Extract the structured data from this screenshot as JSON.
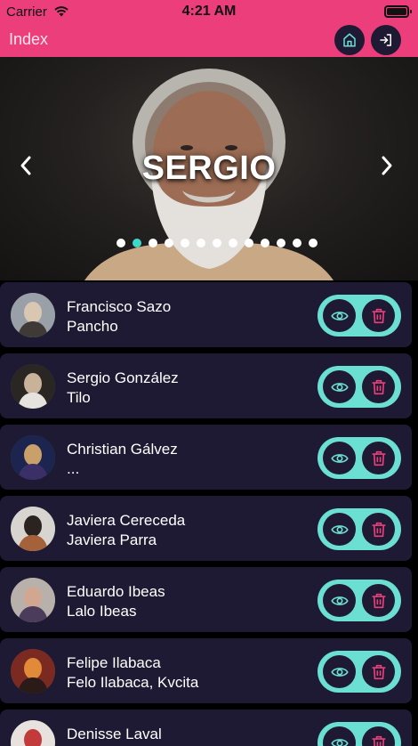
{
  "status_bar": {
    "carrier": "Carrier",
    "time": "4:21 AM"
  },
  "header": {
    "title": "Index"
  },
  "carousel": {
    "current_name": "SERGIO",
    "slide_count": 13,
    "active_index": 1
  },
  "artists": [
    {
      "name": "Francisco Sazo",
      "alias": "Pancho",
      "avatar_colors": [
        "#9aa0a8",
        "#d9c7b2",
        "#3f3a36"
      ]
    },
    {
      "name": "Sergio González",
      "alias": "Tilo",
      "avatar_colors": [
        "#2a2624",
        "#c9b29a",
        "#e6e3df"
      ]
    },
    {
      "name": "Christian Gálvez",
      "alias": "...",
      "avatar_colors": [
        "#1c2550",
        "#c9a06a",
        "#3b2f68"
      ]
    },
    {
      "name": "Javiera Cereceda",
      "alias": "Javiera Parra",
      "avatar_colors": [
        "#d8d4d0",
        "#2b2320",
        "#a5623a"
      ]
    },
    {
      "name": "Eduardo Ibeas",
      "alias": "Lalo Ibeas",
      "avatar_colors": [
        "#b8b0aa",
        "#d2a792",
        "#4c3c5c"
      ]
    },
    {
      "name": "Felipe Ilabaca",
      "alias": "Felo Ilabaca, Kvcita",
      "avatar_colors": [
        "#7a2a20",
        "#e08a3a",
        "#2a1a18"
      ]
    },
    {
      "name": "Denisse Laval",
      "alias": "",
      "avatar_colors": [
        "#e8e2df",
        "#c23a3a",
        "#f2ece8"
      ]
    }
  ],
  "icons": {
    "home": "home-icon",
    "exit": "login-arrow-icon",
    "view": "eye-icon",
    "delete": "trash-icon",
    "prev": "chevron-left-icon",
    "next": "chevron-right-icon"
  },
  "colors": {
    "header": "#ec3e7a",
    "card": "#1e1a33",
    "accent": "#6cdfd3",
    "delete": "#ec3e7a",
    "dot_active": "#3dd9c8"
  }
}
